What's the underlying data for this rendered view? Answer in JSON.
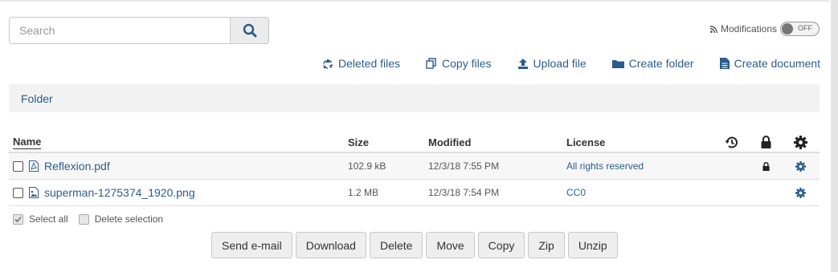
{
  "search": {
    "placeholder": "Search"
  },
  "modifications": {
    "label": "Modifications",
    "state": "OFF"
  },
  "actions": [
    {
      "label": "Deleted files",
      "icon": "recycle-icon"
    },
    {
      "label": "Copy files",
      "icon": "copy-icon"
    },
    {
      "label": "Upload file",
      "icon": "upload-icon"
    },
    {
      "label": "Create folder",
      "icon": "folder-icon"
    },
    {
      "label": "Create document",
      "icon": "document-icon"
    }
  ],
  "breadcrumb": {
    "label": "Folder"
  },
  "table": {
    "headers": {
      "name": "Name",
      "size": "Size",
      "modified": "Modified",
      "license": "License"
    },
    "rows": [
      {
        "name": "Reflexion.pdf",
        "size": "102.9 kB",
        "modified": "12/3/18 7:55 PM",
        "license": "All rights reserved",
        "type_icon": "pdf-file-icon",
        "locked": true
      },
      {
        "name": "superman-1275374_1920.png",
        "size": "1.2 MB",
        "modified": "12/3/18 7:54 PM",
        "license": "CC0",
        "type_icon": "image-file-icon",
        "locked": false
      }
    ]
  },
  "selection": {
    "select_all": "Select all",
    "delete_selection": "Delete selection"
  },
  "buttons": {
    "send_email": "Send e-mail",
    "download": "Download",
    "delete": "Delete",
    "move": "Move",
    "copy": "Copy",
    "zip": "Zip",
    "unzip": "Unzip"
  },
  "colors": {
    "link": "#2a5d8c",
    "icon": "#2a5d8c",
    "bar": "#f2f2f2"
  }
}
